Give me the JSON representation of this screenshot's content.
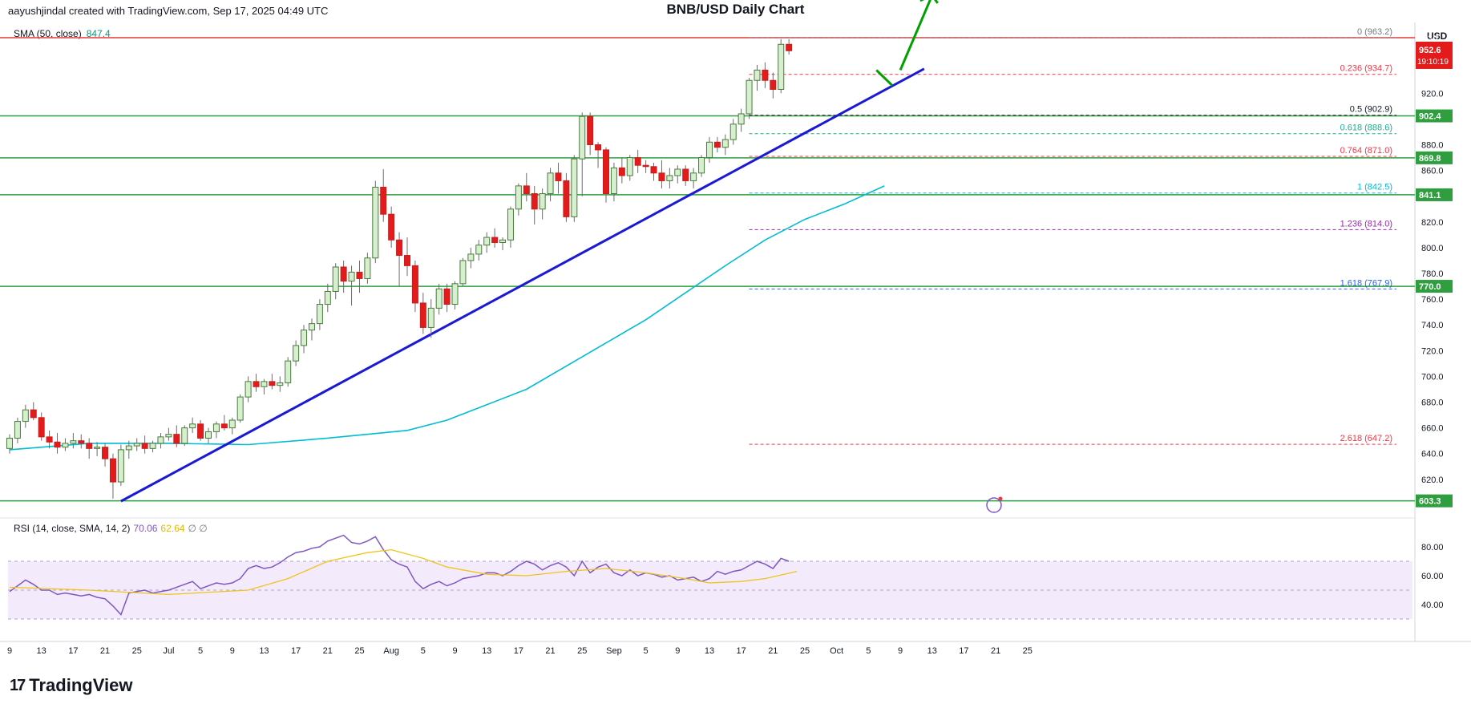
{
  "header": {
    "creator_line": "aayushjindal created with TradingView.com, Sep 17, 2025 04:49 UTC",
    "brand": "TradingView",
    "logo_mark": "17"
  },
  "chart_data": {
    "type": "candlestick",
    "title": "BNB/USD Daily Chart",
    "currency": "USD",
    "price_axis": {
      "range": [
        590,
        975
      ],
      "ticks": [
        620,
        640,
        660,
        680,
        700,
        720,
        740,
        760,
        780,
        800,
        820,
        840,
        860,
        880,
        920
      ]
    },
    "x_axis": {
      "labels": [
        "9",
        "13",
        "17",
        "21",
        "25",
        "Jul",
        "5",
        "9",
        "13",
        "17",
        "21",
        "25",
        "Aug",
        "5",
        "9",
        "13",
        "17",
        "21",
        "25",
        "Sep",
        "5",
        "9",
        "13",
        "17",
        "21",
        "25",
        "Oct",
        "5",
        "9",
        "13",
        "17",
        "21",
        "25"
      ],
      "first_date": "2025-06-09",
      "label_step_days": 4
    },
    "candles": [
      {
        "o": 644,
        "h": 655,
        "l": 640,
        "c": 652
      },
      {
        "o": 652,
        "h": 668,
        "l": 648,
        "c": 665
      },
      {
        "o": 665,
        "h": 678,
        "l": 660,
        "c": 674
      },
      {
        "o": 674,
        "h": 680,
        "l": 666,
        "c": 668
      },
      {
        "o": 668,
        "h": 672,
        "l": 650,
        "c": 653
      },
      {
        "o": 653,
        "h": 658,
        "l": 644,
        "c": 649
      },
      {
        "o": 649,
        "h": 656,
        "l": 640,
        "c": 645
      },
      {
        "o": 645,
        "h": 652,
        "l": 642,
        "c": 648
      },
      {
        "o": 648,
        "h": 656,
        "l": 644,
        "c": 650
      },
      {
        "o": 650,
        "h": 655,
        "l": 644,
        "c": 648
      },
      {
        "o": 648,
        "h": 652,
        "l": 636,
        "c": 644
      },
      {
        "o": 644,
        "h": 649,
        "l": 638,
        "c": 645
      },
      {
        "o": 645,
        "h": 648,
        "l": 630,
        "c": 636
      },
      {
        "o": 636,
        "h": 640,
        "l": 605,
        "c": 618
      },
      {
        "o": 618,
        "h": 647,
        "l": 615,
        "c": 643
      },
      {
        "o": 643,
        "h": 650,
        "l": 636,
        "c": 646
      },
      {
        "o": 646,
        "h": 652,
        "l": 642,
        "c": 648
      },
      {
        "o": 648,
        "h": 654,
        "l": 640,
        "c": 644
      },
      {
        "o": 644,
        "h": 650,
        "l": 641,
        "c": 648
      },
      {
        "o": 648,
        "h": 656,
        "l": 644,
        "c": 653
      },
      {
        "o": 653,
        "h": 660,
        "l": 650,
        "c": 655
      },
      {
        "o": 655,
        "h": 662,
        "l": 645,
        "c": 648
      },
      {
        "o": 648,
        "h": 662,
        "l": 646,
        "c": 660
      },
      {
        "o": 660,
        "h": 668,
        "l": 656,
        "c": 663
      },
      {
        "o": 663,
        "h": 666,
        "l": 650,
        "c": 652
      },
      {
        "o": 652,
        "h": 660,
        "l": 648,
        "c": 657
      },
      {
        "o": 657,
        "h": 665,
        "l": 652,
        "c": 663
      },
      {
        "o": 663,
        "h": 670,
        "l": 658,
        "c": 660
      },
      {
        "o": 660,
        "h": 668,
        "l": 655,
        "c": 666
      },
      {
        "o": 666,
        "h": 686,
        "l": 664,
        "c": 684
      },
      {
        "o": 684,
        "h": 700,
        "l": 680,
        "c": 696
      },
      {
        "o": 696,
        "h": 702,
        "l": 688,
        "c": 692
      },
      {
        "o": 692,
        "h": 698,
        "l": 686,
        "c": 696
      },
      {
        "o": 696,
        "h": 702,
        "l": 690,
        "c": 693
      },
      {
        "o": 693,
        "h": 700,
        "l": 688,
        "c": 695
      },
      {
        "o": 695,
        "h": 715,
        "l": 692,
        "c": 712
      },
      {
        "o": 712,
        "h": 728,
        "l": 708,
        "c": 724
      },
      {
        "o": 724,
        "h": 740,
        "l": 718,
        "c": 736
      },
      {
        "o": 736,
        "h": 745,
        "l": 728,
        "c": 741
      },
      {
        "o": 741,
        "h": 760,
        "l": 736,
        "c": 756
      },
      {
        "o": 756,
        "h": 772,
        "l": 750,
        "c": 766
      },
      {
        "o": 766,
        "h": 788,
        "l": 760,
        "c": 785
      },
      {
        "o": 785,
        "h": 790,
        "l": 765,
        "c": 774
      },
      {
        "o": 774,
        "h": 786,
        "l": 755,
        "c": 781
      },
      {
        "o": 781,
        "h": 790,
        "l": 765,
        "c": 776
      },
      {
        "o": 776,
        "h": 796,
        "l": 772,
        "c": 792
      },
      {
        "o": 792,
        "h": 852,
        "l": 788,
        "c": 847
      },
      {
        "o": 847,
        "h": 861,
        "l": 820,
        "c": 826
      },
      {
        "o": 826,
        "h": 832,
        "l": 800,
        "c": 806
      },
      {
        "o": 806,
        "h": 812,
        "l": 770,
        "c": 794
      },
      {
        "o": 794,
        "h": 808,
        "l": 778,
        "c": 786
      },
      {
        "o": 786,
        "h": 790,
        "l": 750,
        "c": 757
      },
      {
        "o": 757,
        "h": 765,
        "l": 733,
        "c": 738
      },
      {
        "o": 738,
        "h": 760,
        "l": 730,
        "c": 753
      },
      {
        "o": 753,
        "h": 772,
        "l": 748,
        "c": 768
      },
      {
        "o": 768,
        "h": 772,
        "l": 750,
        "c": 756
      },
      {
        "o": 756,
        "h": 774,
        "l": 752,
        "c": 772
      },
      {
        "o": 772,
        "h": 792,
        "l": 770,
        "c": 790
      },
      {
        "o": 790,
        "h": 800,
        "l": 784,
        "c": 795
      },
      {
        "o": 795,
        "h": 806,
        "l": 790,
        "c": 802
      },
      {
        "o": 802,
        "h": 812,
        "l": 796,
        "c": 808
      },
      {
        "o": 808,
        "h": 815,
        "l": 800,
        "c": 804
      },
      {
        "o": 804,
        "h": 808,
        "l": 798,
        "c": 806
      },
      {
        "o": 806,
        "h": 832,
        "l": 800,
        "c": 830
      },
      {
        "o": 830,
        "h": 850,
        "l": 825,
        "c": 848
      },
      {
        "o": 848,
        "h": 858,
        "l": 836,
        "c": 842
      },
      {
        "o": 842,
        "h": 848,
        "l": 818,
        "c": 830
      },
      {
        "o": 830,
        "h": 846,
        "l": 822,
        "c": 842
      },
      {
        "o": 842,
        "h": 862,
        "l": 836,
        "c": 858
      },
      {
        "o": 858,
        "h": 866,
        "l": 842,
        "c": 852
      },
      {
        "o": 852,
        "h": 858,
        "l": 820,
        "c": 824
      },
      {
        "o": 824,
        "h": 872,
        "l": 820,
        "c": 869
      },
      {
        "o": 869,
        "h": 905,
        "l": 840,
        "c": 902
      },
      {
        "o": 902,
        "h": 905,
        "l": 872,
        "c": 880
      },
      {
        "o": 880,
        "h": 882,
        "l": 862,
        "c": 876
      },
      {
        "o": 876,
        "h": 878,
        "l": 835,
        "c": 842
      },
      {
        "o": 842,
        "h": 866,
        "l": 836,
        "c": 862
      },
      {
        "o": 862,
        "h": 870,
        "l": 850,
        "c": 856
      },
      {
        "o": 856,
        "h": 872,
        "l": 852,
        "c": 870
      },
      {
        "o": 870,
        "h": 876,
        "l": 858,
        "c": 864
      },
      {
        "o": 864,
        "h": 868,
        "l": 858,
        "c": 863
      },
      {
        "o": 863,
        "h": 866,
        "l": 852,
        "c": 858
      },
      {
        "o": 858,
        "h": 868,
        "l": 846,
        "c": 852
      },
      {
        "o": 852,
        "h": 862,
        "l": 846,
        "c": 856
      },
      {
        "o": 856,
        "h": 864,
        "l": 850,
        "c": 861
      },
      {
        "o": 861,
        "h": 864,
        "l": 848,
        "c": 852
      },
      {
        "o": 852,
        "h": 862,
        "l": 846,
        "c": 858
      },
      {
        "o": 858,
        "h": 872,
        "l": 855,
        "c": 870
      },
      {
        "o": 870,
        "h": 886,
        "l": 866,
        "c": 882
      },
      {
        "o": 882,
        "h": 886,
        "l": 874,
        "c": 878
      },
      {
        "o": 878,
        "h": 888,
        "l": 872,
        "c": 884
      },
      {
        "o": 884,
        "h": 900,
        "l": 880,
        "c": 896
      },
      {
        "o": 896,
        "h": 908,
        "l": 890,
        "c": 904
      },
      {
        "o": 904,
        "h": 932,
        "l": 900,
        "c": 930
      },
      {
        "o": 930,
        "h": 942,
        "l": 922,
        "c": 938
      },
      {
        "o": 938,
        "h": 944,
        "l": 924,
        "c": 930
      },
      {
        "o": 930,
        "h": 936,
        "l": 916,
        "c": 923
      },
      {
        "o": 923,
        "h": 962,
        "l": 920,
        "c": 958
      },
      {
        "o": 958,
        "h": 962,
        "l": 950,
        "c": 953
      }
    ],
    "sma50": {
      "label": "SMA (50, close)",
      "value": "847.4",
      "points": [
        [
          0,
          643
        ],
        [
          10,
          648
        ],
        [
          20,
          648
        ],
        [
          30,
          647
        ],
        [
          40,
          652
        ],
        [
          50,
          658
        ],
        [
          55,
          666
        ],
        [
          60,
          678
        ],
        [
          65,
          690
        ],
        [
          70,
          708
        ],
        [
          75,
          726
        ],
        [
          80,
          744
        ],
        [
          85,
          765
        ],
        [
          90,
          786
        ],
        [
          95,
          806
        ],
        [
          100,
          822
        ],
        [
          105,
          834
        ],
        [
          110,
          848
        ]
      ]
    },
    "fib_levels": [
      {
        "label": "0",
        "price": 963.2,
        "color": "#787b86"
      },
      {
        "label": "0.236",
        "price": 934.7,
        "color": "#f23645"
      },
      {
        "label": "0.5",
        "price": 902.9,
        "color": "#131722"
      },
      {
        "label": "0.618",
        "price": 888.6,
        "color": "#22ab94"
      },
      {
        "label": "0.764",
        "price": 871.0,
        "color": "#f23645"
      },
      {
        "label": "1",
        "price": 842.5,
        "color": "#00bcd4"
      },
      {
        "label": "1.236",
        "price": 814.0,
        "color": "#9c27b0"
      },
      {
        "label": "1.618",
        "price": 767.9,
        "color": "#2962ff"
      },
      {
        "label": "2.618",
        "price": 647.2,
        "color": "#f23645"
      }
    ],
    "horizontal_lines": [
      {
        "price": 902.4,
        "label": "902.4"
      },
      {
        "price": 869.8,
        "label": "869.8"
      },
      {
        "price": 841.1,
        "label": "841.1"
      },
      {
        "price": 770.0,
        "label": "770.0"
      },
      {
        "price": 603.3,
        "label": "603.3"
      }
    ],
    "resistance_line": {
      "price": 963.2
    },
    "price_tag": {
      "value": "952.6",
      "countdown": "19:10:19",
      "hidden_top": "963.2"
    },
    "trendline": {
      "from": [
        14,
        603
      ],
      "to": [
        115,
        939
      ]
    },
    "rsi": {
      "label": "RSI (14, close, SMA, 14, 2)",
      "value": "70.06",
      "sma_value": "62.64",
      "extra": "∅ ∅",
      "ticks": [
        40,
        60,
        80
      ],
      "bands": [
        30,
        50,
        70
      ],
      "points": [
        49,
        53,
        57,
        54,
        50,
        50,
        47,
        48,
        47,
        46,
        47,
        45,
        44,
        39,
        33,
        48,
        49,
        50,
        48,
        49,
        50,
        52,
        54,
        56,
        51,
        53,
        55,
        54,
        55,
        58,
        65,
        67,
        65,
        66,
        69,
        73,
        76,
        77,
        79,
        80,
        84,
        86,
        88,
        83,
        82,
        84,
        87,
        78,
        71,
        68,
        66,
        56,
        51,
        54,
        56,
        53,
        55,
        58,
        59,
        60,
        62,
        62,
        60,
        63,
        67,
        70,
        68,
        64,
        67,
        69,
        66,
        60,
        70,
        62,
        66,
        68,
        62,
        60,
        64,
        60,
        62,
        61,
        59,
        60,
        57,
        58,
        59,
        56,
        58,
        63,
        61,
        63,
        64,
        67,
        70,
        68,
        65,
        72,
        70
      ],
      "sma_points": [
        [
          0,
          52
        ],
        [
          10,
          50
        ],
        [
          20,
          47
        ],
        [
          30,
          50
        ],
        [
          35,
          58
        ],
        [
          40,
          70
        ],
        [
          45,
          76
        ],
        [
          48,
          78
        ],
        [
          52,
          72
        ],
        [
          55,
          66
        ],
        [
          60,
          61
        ],
        [
          65,
          60
        ],
        [
          70,
          63
        ],
        [
          75,
          65
        ],
        [
          80,
          62
        ],
        [
          85,
          58
        ],
        [
          88,
          55
        ],
        [
          92,
          56
        ],
        [
          95,
          58
        ],
        [
          99,
          63
        ]
      ]
    },
    "annotations": {
      "arrow_color": "#00a000"
    }
  }
}
